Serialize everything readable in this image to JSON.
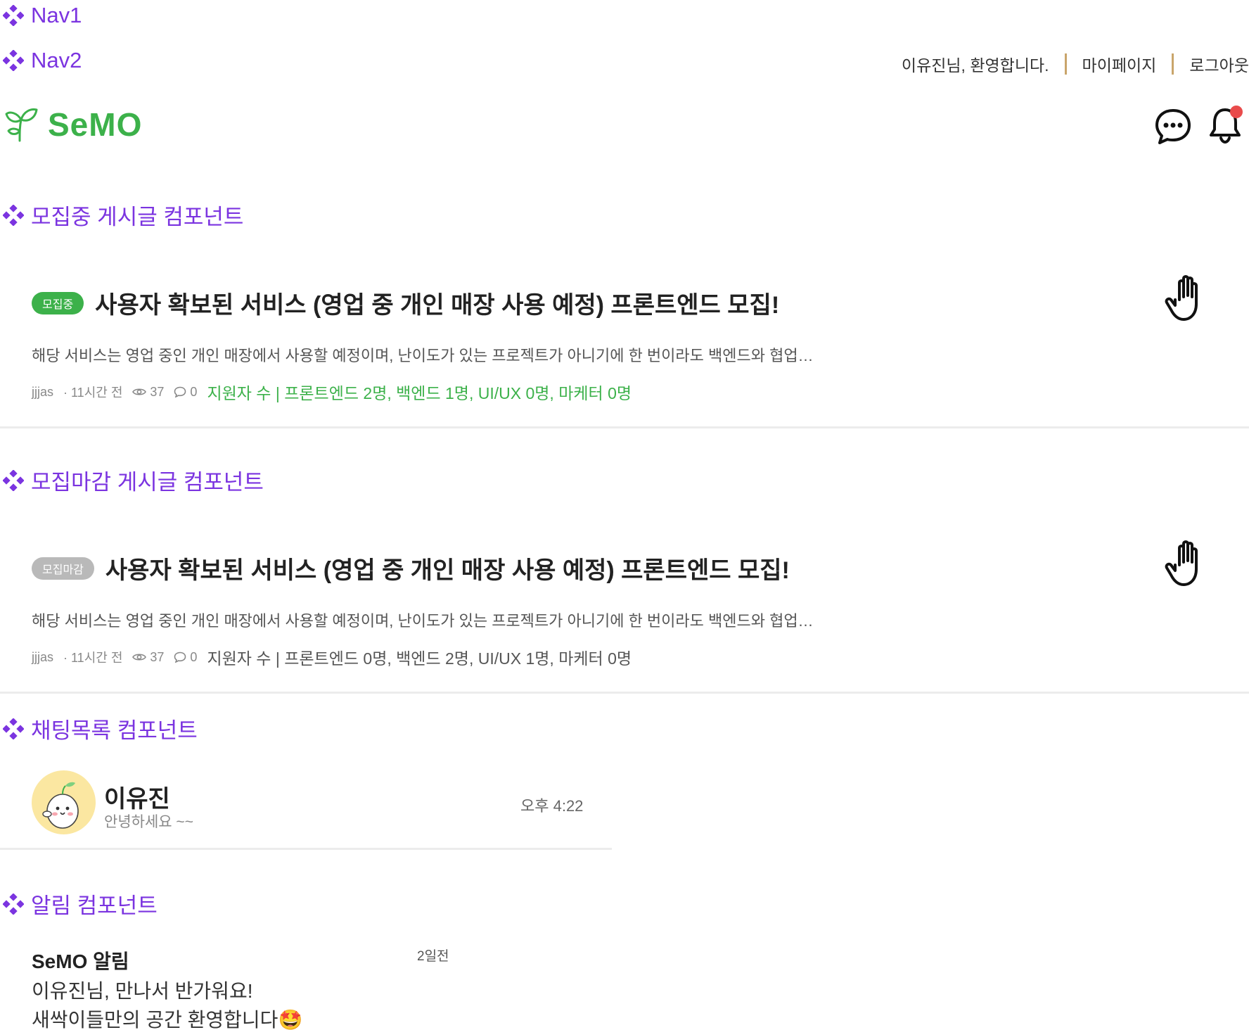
{
  "labels": {
    "nav1": "Nav1",
    "nav2": "Nav2",
    "recruiting": "모집중 게시글 컴포넌트",
    "closed": "모집마감 게시글 컴포넌트",
    "chat_list": "채팅목록 컴포넌트",
    "notification": "알림 컴포넌트"
  },
  "header": {
    "welcome": "이유진님, 환영합니다.",
    "mypage": "마이페이지",
    "logout": "로그아웃",
    "logo": "SeMO"
  },
  "colors": {
    "label_purple": "#7b34e0",
    "brand_green": "#3cb14a",
    "divider": "#c9a56b",
    "notification_dot": "#e94b4b"
  },
  "posts": [
    {
      "badge": "모집중",
      "title": "사용자 확보된 서비스 (영업 중 개인 매장 사용 예정) 프론트엔드 모집!",
      "desc": "해당 서비스는 영업 중인 개인 매장에서 사용할 예정이며, 난이도가 있는 프로젝트가 아니기에 한 번이라도 백엔드와 협업…",
      "author": "jjjas",
      "time": "· 11시간 전",
      "views": "37",
      "comments": "0",
      "applicants": "지원자 수 | 프론트엔드 2명, 백엔드 1명, UI/UX 0명, 마케터 0명"
    },
    {
      "badge": "모집마감",
      "title": "사용자 확보된 서비스 (영업 중 개인 매장 사용 예정) 프론트엔드 모집!",
      "desc": "해당 서비스는 영업 중인 개인 매장에서 사용할 예정이며, 난이도가 있는 프로젝트가 아니기에 한 번이라도 백엔드와 협업…",
      "author": "jjjas",
      "time": "· 11시간 전",
      "views": "37",
      "comments": "0",
      "applicants": "지원자 수 | 프론트엔드 0명, 백엔드 2명, UI/UX 1명, 마케터 0명"
    }
  ],
  "chat": {
    "name": "이유진",
    "preview": "안녕하세요 ~~",
    "time": "오후 4:22"
  },
  "notification": {
    "title": "SeMO 알림",
    "time": "2일전",
    "line1": "이유진님, 만나서 반가워요!",
    "line2": "새싹이들만의 공간 환영합니다🤩"
  }
}
